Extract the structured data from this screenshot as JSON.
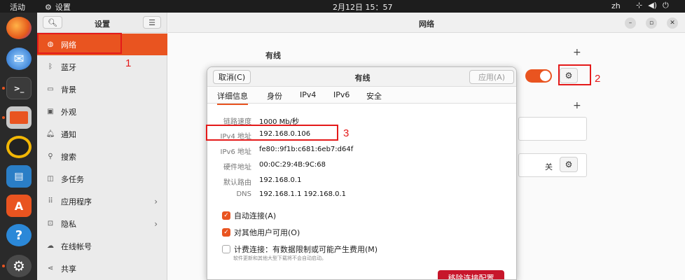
{
  "topbar": {
    "activities": "活动",
    "app_name": "设置",
    "clock": "2月12日 15：57",
    "lang": "zh",
    "sys_icons": [
      "network-icon",
      "volume-icon",
      "power-icon"
    ]
  },
  "dock": {
    "apps": [
      "firefox-icon",
      "thunderbird-icon",
      "terminal-icon",
      "files-icon",
      "rhythmbox-icon",
      "writer-icon",
      "software-icon",
      "help-icon",
      "settings-icon"
    ]
  },
  "sidebar": {
    "title": "设置",
    "items": [
      {
        "label": "网络",
        "icon": "network-icon",
        "active": true
      },
      {
        "label": "蓝牙",
        "icon": "bluetooth-icon"
      },
      {
        "label": "背景",
        "icon": "background-icon"
      },
      {
        "label": "外观",
        "icon": "appearance-icon"
      },
      {
        "label": "通知",
        "icon": "bell-icon"
      },
      {
        "label": "搜索",
        "icon": "search-icon"
      },
      {
        "label": "多任务",
        "icon": "multitask-icon"
      },
      {
        "label": "应用程序",
        "icon": "apps-icon",
        "chevron": true
      },
      {
        "label": "隐私",
        "icon": "lock-icon",
        "chevron": true
      },
      {
        "label": "在线帐号",
        "icon": "cloud-icon"
      },
      {
        "label": "共享",
        "icon": "share-icon"
      }
    ]
  },
  "main": {
    "title": "网络",
    "wired_label": "有线",
    "off_label": "关"
  },
  "dialog": {
    "cancel_label": "取消(C)",
    "title": "有线",
    "apply_label": "应用(A)",
    "tabs": [
      "详细信息",
      "身份",
      "IPv4",
      "IPv6",
      "安全"
    ],
    "details": [
      {
        "key": "链路速度",
        "value": "1000 Mb/秒"
      },
      {
        "key": "IPv4 地址",
        "value": "192.168.0.106"
      },
      {
        "key": "IPv6 地址",
        "value": "fe80::9f1b:c681:6eb7:d64f"
      },
      {
        "key": "硬件地址",
        "value": "00:0C:29:4B:9C:68"
      },
      {
        "key": "默认路由",
        "value": "192.168.0.1"
      },
      {
        "key": "DNS",
        "value": "192.168.1.1 192.168.0.1"
      }
    ],
    "auto_connect": "自动连接(A)",
    "all_users": "对其他用户可用(O)",
    "metered": "计费连接：有数据限制或可能产生费用(M)",
    "metered_note": "软件更新和其他大型下载将不会自动启动。",
    "remove_label": "移除连接配置"
  },
  "annotations": [
    "1",
    "2",
    "3"
  ],
  "colors": {
    "accent": "#e95420",
    "annotation": "#e41a1a",
    "danger": "#c7162b"
  }
}
